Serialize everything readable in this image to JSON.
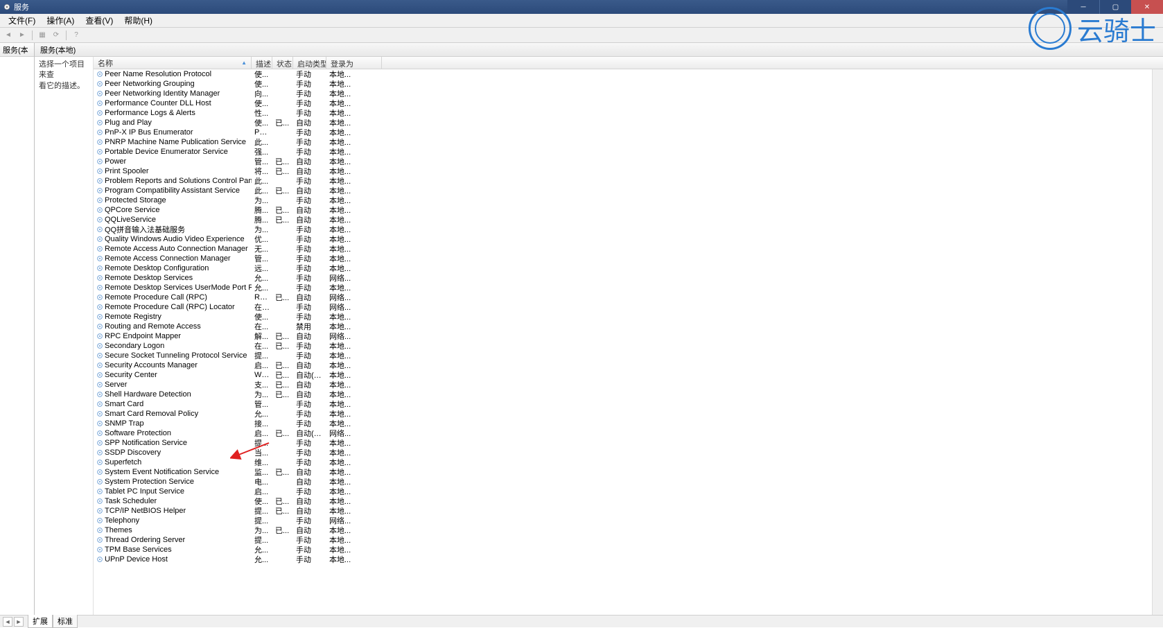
{
  "window": {
    "title": "服务",
    "menu": [
      "文件(F)",
      "操作(A)",
      "查看(V)",
      "帮助(H)"
    ]
  },
  "tree": {
    "root": "服务(本"
  },
  "pane_title": "服务(本地)",
  "desc_panel": {
    "line1": "选择一个项目来查",
    "line2": "看它的描述。"
  },
  "columns": {
    "name": "名称",
    "desc": "描述",
    "status": "状态",
    "startup": "启动类型",
    "logon": "登录为"
  },
  "services": [
    {
      "name": "Peer Name Resolution Protocol",
      "desc": "使...",
      "status": "",
      "startup": "手动",
      "logon": "本地..."
    },
    {
      "name": "Peer Networking Grouping",
      "desc": "使...",
      "status": "",
      "startup": "手动",
      "logon": "本地..."
    },
    {
      "name": "Peer Networking Identity Manager",
      "desc": "向...",
      "status": "",
      "startup": "手动",
      "logon": "本地..."
    },
    {
      "name": "Performance Counter DLL Host",
      "desc": "使...",
      "status": "",
      "startup": "手动",
      "logon": "本地..."
    },
    {
      "name": "Performance Logs & Alerts",
      "desc": "性...",
      "status": "",
      "startup": "手动",
      "logon": "本地..."
    },
    {
      "name": "Plug and Play",
      "desc": "使...",
      "status": "已...",
      "startup": "自动",
      "logon": "本地..."
    },
    {
      "name": "PnP-X IP Bus Enumerator",
      "desc": "Pn...",
      "status": "",
      "startup": "手动",
      "logon": "本地..."
    },
    {
      "name": "PNRP Machine Name Publication Service",
      "desc": "此...",
      "status": "",
      "startup": "手动",
      "logon": "本地..."
    },
    {
      "name": "Portable Device Enumerator Service",
      "desc": "强...",
      "status": "",
      "startup": "手动",
      "logon": "本地..."
    },
    {
      "name": "Power",
      "desc": "管...",
      "status": "已...",
      "startup": "自动",
      "logon": "本地..."
    },
    {
      "name": "Print Spooler",
      "desc": "将...",
      "status": "已...",
      "startup": "自动",
      "logon": "本地..."
    },
    {
      "name": "Problem Reports and Solutions Control Panel ...",
      "desc": "此...",
      "status": "",
      "startup": "手动",
      "logon": "本地..."
    },
    {
      "name": "Program Compatibility Assistant Service",
      "desc": "此...",
      "status": "已...",
      "startup": "自动",
      "logon": "本地..."
    },
    {
      "name": "Protected Storage",
      "desc": "为...",
      "status": "",
      "startup": "手动",
      "logon": "本地..."
    },
    {
      "name": "QPCore Service",
      "desc": "腾...",
      "status": "已...",
      "startup": "自动",
      "logon": "本地..."
    },
    {
      "name": "QQLiveService",
      "desc": "腾...",
      "status": "已...",
      "startup": "自动",
      "logon": "本地..."
    },
    {
      "name": "QQ拼音输入法基础服务",
      "desc": "为...",
      "status": "",
      "startup": "手动",
      "logon": "本地..."
    },
    {
      "name": "Quality Windows Audio Video Experience",
      "desc": "优...",
      "status": "",
      "startup": "手动",
      "logon": "本地..."
    },
    {
      "name": "Remote Access Auto Connection Manager",
      "desc": "无...",
      "status": "",
      "startup": "手动",
      "logon": "本地..."
    },
    {
      "name": "Remote Access Connection Manager",
      "desc": "管...",
      "status": "",
      "startup": "手动",
      "logon": "本地..."
    },
    {
      "name": "Remote Desktop Configuration",
      "desc": "远...",
      "status": "",
      "startup": "手动",
      "logon": "本地..."
    },
    {
      "name": "Remote Desktop Services",
      "desc": "允...",
      "status": "",
      "startup": "手动",
      "logon": "网络..."
    },
    {
      "name": "Remote Desktop Services UserMode Port Red...",
      "desc": "允...",
      "status": "",
      "startup": "手动",
      "logon": "本地..."
    },
    {
      "name": "Remote Procedure Call (RPC)",
      "desc": "RP...",
      "status": "已...",
      "startup": "自动",
      "logon": "网络..."
    },
    {
      "name": "Remote Procedure Call (RPC) Locator",
      "desc": "在 ...",
      "status": "",
      "startup": "手动",
      "logon": "网络..."
    },
    {
      "name": "Remote Registry",
      "desc": "使...",
      "status": "",
      "startup": "手动",
      "logon": "本地..."
    },
    {
      "name": "Routing and Remote Access",
      "desc": "在...",
      "status": "",
      "startup": "禁用",
      "logon": "本地..."
    },
    {
      "name": "RPC Endpoint Mapper",
      "desc": "解...",
      "status": "已...",
      "startup": "自动",
      "logon": "网络..."
    },
    {
      "name": "Secondary Logon",
      "desc": "在...",
      "status": "已...",
      "startup": "手动",
      "logon": "本地..."
    },
    {
      "name": "Secure Socket Tunneling Protocol Service",
      "desc": "提...",
      "status": "",
      "startup": "手动",
      "logon": "本地..."
    },
    {
      "name": "Security Accounts Manager",
      "desc": "启...",
      "status": "已...",
      "startup": "自动",
      "logon": "本地..."
    },
    {
      "name": "Security Center",
      "desc": "WS...",
      "status": "已...",
      "startup": "自动(延...",
      "logon": "本地..."
    },
    {
      "name": "Server",
      "desc": "支...",
      "status": "已...",
      "startup": "自动",
      "logon": "本地..."
    },
    {
      "name": "Shell Hardware Detection",
      "desc": "为...",
      "status": "已...",
      "startup": "自动",
      "logon": "本地..."
    },
    {
      "name": "Smart Card",
      "desc": "管...",
      "status": "",
      "startup": "手动",
      "logon": "本地..."
    },
    {
      "name": "Smart Card Removal Policy",
      "desc": "允...",
      "status": "",
      "startup": "手动",
      "logon": "本地..."
    },
    {
      "name": "SNMP Trap",
      "desc": "接...",
      "status": "",
      "startup": "手动",
      "logon": "本地..."
    },
    {
      "name": "Software Protection",
      "desc": "启...",
      "status": "已...",
      "startup": "自动(延...",
      "logon": "网络..."
    },
    {
      "name": "SPP Notification Service",
      "desc": "提...",
      "status": "",
      "startup": "手动",
      "logon": "本地..."
    },
    {
      "name": "SSDP Discovery",
      "desc": "当...",
      "status": "",
      "startup": "手动",
      "logon": "本地..."
    },
    {
      "name": "Superfetch",
      "desc": "维...",
      "status": "",
      "startup": "手动",
      "logon": "本地..."
    },
    {
      "name": "System Event Notification Service",
      "desc": "监...",
      "status": "已...",
      "startup": "自动",
      "logon": "本地..."
    },
    {
      "name": "System Protection Service",
      "desc": "电...",
      "status": "",
      "startup": "自动",
      "logon": "本地..."
    },
    {
      "name": "Tablet PC Input Service",
      "desc": "启...",
      "status": "",
      "startup": "手动",
      "logon": "本地..."
    },
    {
      "name": "Task Scheduler",
      "desc": "使...",
      "status": "已...",
      "startup": "自动",
      "logon": "本地..."
    },
    {
      "name": "TCP/IP NetBIOS Helper",
      "desc": "提...",
      "status": "已...",
      "startup": "自动",
      "logon": "本地..."
    },
    {
      "name": "Telephony",
      "desc": "提...",
      "status": "",
      "startup": "手动",
      "logon": "网络..."
    },
    {
      "name": "Themes",
      "desc": "为...",
      "status": "已...",
      "startup": "自动",
      "logon": "本地..."
    },
    {
      "name": "Thread Ordering Server",
      "desc": "提...",
      "status": "",
      "startup": "手动",
      "logon": "本地..."
    },
    {
      "name": "TPM Base Services",
      "desc": "允...",
      "status": "",
      "startup": "手动",
      "logon": "本地..."
    },
    {
      "name": "UPnP Device Host",
      "desc": "允...",
      "status": "",
      "startup": "手动",
      "logon": "本地..."
    }
  ],
  "tabs": {
    "extended": "扩展",
    "standard": "标准"
  },
  "watermark": "云骑士"
}
